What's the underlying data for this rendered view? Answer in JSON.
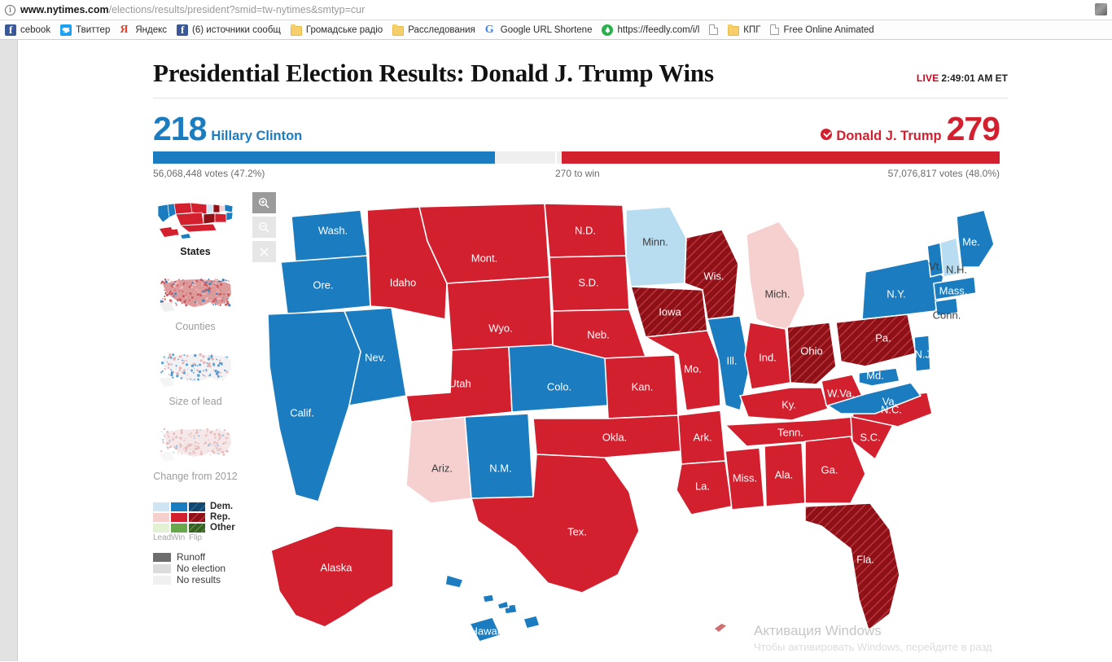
{
  "browser": {
    "url_bold": "www.nytimes.com",
    "url_rest": "/elections/results/president?smid=tw-nytimes&smtyp=cur",
    "info_icon": "info-icon",
    "bookmarks": [
      {
        "label": "cebook",
        "icon": "facebook-icon"
      },
      {
        "label": "Твиттер",
        "icon": "twitter-icon"
      },
      {
        "label": "Яндекс",
        "icon": "yandex-icon"
      },
      {
        "label": "(6) источники сообщ",
        "icon": "facebook-icon"
      },
      {
        "label": "Громадське радіо",
        "icon": "folder-icon"
      },
      {
        "label": "Расследования",
        "icon": "folder-icon"
      },
      {
        "label": "Google URL Shortene",
        "icon": "google-icon"
      },
      {
        "label": "https://feedly.com/i/l",
        "icon": "feedly-icon"
      },
      {
        "label": "",
        "icon": "page-icon"
      },
      {
        "label": "КПГ",
        "icon": "folder-icon"
      },
      {
        "label": "Free Online Animated",
        "icon": "page-icon"
      }
    ]
  },
  "header": {
    "title": "Presidential Election Results: Donald J. Trump Wins",
    "live_label": "LIVE",
    "live_time": "2:49:01 AM ET"
  },
  "results": {
    "democrat": {
      "name": "Hillary Clinton",
      "electoral_votes": "218",
      "votes_text": "56,068,448 votes (47.2%)",
      "color": "#1c7cc0",
      "bar_percent": 40.4
    },
    "republican": {
      "name": "Donald J. Trump",
      "electoral_votes": "279",
      "votes_text": "57,076,817 votes (48.0%)",
      "color": "#d2202f",
      "bar_percent": 51.7,
      "winner_icon": "check-circle-icon"
    },
    "to_win_label": "270 to win",
    "to_win_position_percent": 47.5,
    "track_color": "#efefef"
  },
  "map_panel": {
    "thumbnails": [
      {
        "label": "States",
        "active": true,
        "name": "map-thumb-states"
      },
      {
        "label": "Counties",
        "active": false,
        "name": "map-thumb-counties"
      },
      {
        "label": "Size of lead",
        "active": false,
        "name": "map-thumb-size-of-lead"
      },
      {
        "label": "Change from 2012",
        "active": false,
        "name": "map-thumb-change-from-2012"
      }
    ],
    "zoom_controls": [
      {
        "name": "zoom-in-button",
        "icon": "magnifier-plus-icon",
        "state": "enabled"
      },
      {
        "name": "zoom-out-button",
        "icon": "magnifier-minus-icon",
        "state": "disabled"
      },
      {
        "name": "reset-zoom-button",
        "icon": "close-icon",
        "state": "disabled"
      }
    ],
    "legend": {
      "rows": [
        {
          "party": "Dem.",
          "lead": "#cfe5f4",
          "win": "#1c7cc0",
          "flip": "#12476f"
        },
        {
          "party": "Rep.",
          "lead": "#f6cfcf",
          "win": "#d2202f",
          "flip": "#8e1118"
        },
        {
          "party": "Other",
          "lead": "#e2f0d3",
          "win": "#68a84b",
          "flip": "#356122"
        }
      ],
      "scale": [
        "Lead",
        "Win",
        "Flip"
      ],
      "status": [
        {
          "label": "Runoff",
          "color": "#6d6d6d"
        },
        {
          "label": "No election",
          "color": "#dcdcdc"
        },
        {
          "label": "No results",
          "color": "#f0f0f0"
        }
      ]
    }
  },
  "chart_data": {
    "type": "map",
    "title": "Presidential Election Results: Donald J. Trump Wins",
    "legend_position": "left",
    "colors": {
      "dem_lead": "#cfe5f4",
      "dem_win": "#1c7cc0",
      "dem_flip": "#12476f",
      "rep_lead": "#f6cfcf",
      "rep_win": "#d2202f",
      "rep_flip": "#8e1118",
      "border": "#ffffff"
    },
    "states": [
      {
        "label": "Wash.",
        "result": "dem_win"
      },
      {
        "label": "Ore.",
        "result": "dem_win"
      },
      {
        "label": "Calif.",
        "result": "dem_win"
      },
      {
        "label": "Nev.",
        "result": "dem_win"
      },
      {
        "label": "Idaho",
        "result": "rep_win"
      },
      {
        "label": "Mont.",
        "result": "rep_win"
      },
      {
        "label": "Wyo.",
        "result": "rep_win"
      },
      {
        "label": "Utah",
        "result": "rep_win"
      },
      {
        "label": "Colo.",
        "result": "dem_win"
      },
      {
        "label": "Ariz.",
        "result": "rep_lead"
      },
      {
        "label": "N.M.",
        "result": "dem_win"
      },
      {
        "label": "N.D.",
        "result": "rep_win"
      },
      {
        "label": "S.D.",
        "result": "rep_win"
      },
      {
        "label": "Neb.",
        "result": "rep_win"
      },
      {
        "label": "Kan.",
        "result": "rep_win"
      },
      {
        "label": "Okla.",
        "result": "rep_win"
      },
      {
        "label": "Tex.",
        "result": "rep_win"
      },
      {
        "label": "Minn.",
        "result": "dem_lead"
      },
      {
        "label": "Iowa",
        "result": "rep_flip"
      },
      {
        "label": "Mo.",
        "result": "rep_win"
      },
      {
        "label": "Ark.",
        "result": "rep_win"
      },
      {
        "label": "La.",
        "result": "rep_win"
      },
      {
        "label": "Wis.",
        "result": "rep_flip"
      },
      {
        "label": "Ill.",
        "result": "dem_win"
      },
      {
        "label": "Mich.",
        "result": "rep_lead"
      },
      {
        "label": "Ind.",
        "result": "rep_win"
      },
      {
        "label": "Ohio",
        "result": "rep_flip"
      },
      {
        "label": "Ky.",
        "result": "rep_win"
      },
      {
        "label": "Tenn.",
        "result": "rep_win"
      },
      {
        "label": "Miss.",
        "result": "rep_win"
      },
      {
        "label": "Ala.",
        "result": "rep_win"
      },
      {
        "label": "Ga.",
        "result": "rep_win"
      },
      {
        "label": "S.C.",
        "result": "rep_win"
      },
      {
        "label": "N.C.",
        "result": "rep_win"
      },
      {
        "label": "Fla.",
        "result": "rep_flip"
      },
      {
        "label": "W.Va.",
        "result": "rep_win"
      },
      {
        "label": "Va.",
        "result": "dem_win"
      },
      {
        "label": "Md.",
        "result": "dem_win"
      },
      {
        "label": "Pa.",
        "result": "rep_flip"
      },
      {
        "label": "N.J.",
        "result": "dem_win"
      },
      {
        "label": "N.Y.",
        "result": "dem_win"
      },
      {
        "label": "Conn.",
        "result": "dem_win"
      },
      {
        "label": "Mass.",
        "result": "dem_win"
      },
      {
        "label": "Vt.",
        "result": "dem_win"
      },
      {
        "label": "N.H.",
        "result": "dem_lead"
      },
      {
        "label": "Me.",
        "result": "dem_win"
      },
      {
        "label": "Alaska",
        "result": "rep_win"
      },
      {
        "label": "Hawaii",
        "result": "dem_win"
      }
    ]
  },
  "windows_watermark": {
    "title": "Активация Windows",
    "subtitle": "Чтобы активировать Windows, перейдите в разд"
  }
}
